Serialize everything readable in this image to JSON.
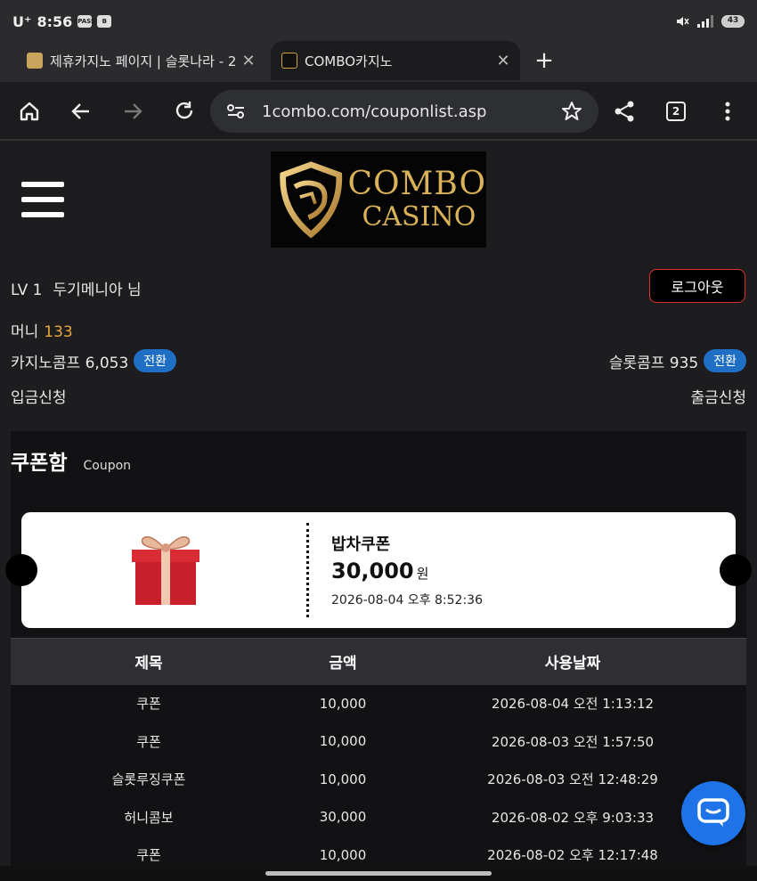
{
  "status_bar": {
    "carrier": "U⁺",
    "time": "8:56",
    "icon_badges": [
      "PASS",
      "B"
    ],
    "battery": "43"
  },
  "tabs": [
    {
      "title": "제휴카지노 페이지 | 슬롯나라 - 2",
      "close_icon": "close-icon"
    },
    {
      "title": "COMBO카지노",
      "close_icon": "close-icon"
    }
  ],
  "toolbar": {
    "url": "1combo.com/couponlist.asp",
    "tab_count": "2"
  },
  "logo": {
    "line1": "COMBO",
    "line2": "CASINO",
    "color": "#d9b25a"
  },
  "user": {
    "level": "LV 1",
    "nickname": "두기메니아 님",
    "logout_label": "로그아웃"
  },
  "money": {
    "label": "머니",
    "value": "133",
    "accent": "#e8a73a"
  },
  "comps": {
    "casino_label": "카지노콤프 6,053",
    "slot_label": "슬롯콤프 935",
    "convert_label": "전환"
  },
  "links": {
    "deposit": "입금신청",
    "withdraw": "출금신청"
  },
  "coupon_section": {
    "title": "쿠폰함",
    "subtitle": "Coupon"
  },
  "featured_coupon": {
    "name": "밥차쿠폰",
    "amount": "30,000",
    "unit": "원",
    "date": "2026-08-04 오후 8:52:36"
  },
  "history": {
    "headers": [
      "제목",
      "금액",
      "사용날짜"
    ],
    "rows": [
      {
        "title": "쿠폰",
        "amount": "10,000",
        "date": "2026-08-04 오전 1:13:12"
      },
      {
        "title": "쿠폰",
        "amount": "10,000",
        "date": "2026-08-03 오전 1:57:50"
      },
      {
        "title": "슬롯루징쿠폰",
        "amount": "10,000",
        "date": "2026-08-03 오전 12:48:29"
      },
      {
        "title": "허니콤보",
        "amount": "30,000",
        "date": "2026-08-02 오후 9:03:33"
      },
      {
        "title": "쿠폰",
        "amount": "10,000",
        "date": "2026-08-02 오후 12:17:48"
      }
    ]
  },
  "colors": {
    "pill": "#1f6fc4",
    "logout_border": "#d9352b",
    "chat_fab": "#1e73e8"
  }
}
